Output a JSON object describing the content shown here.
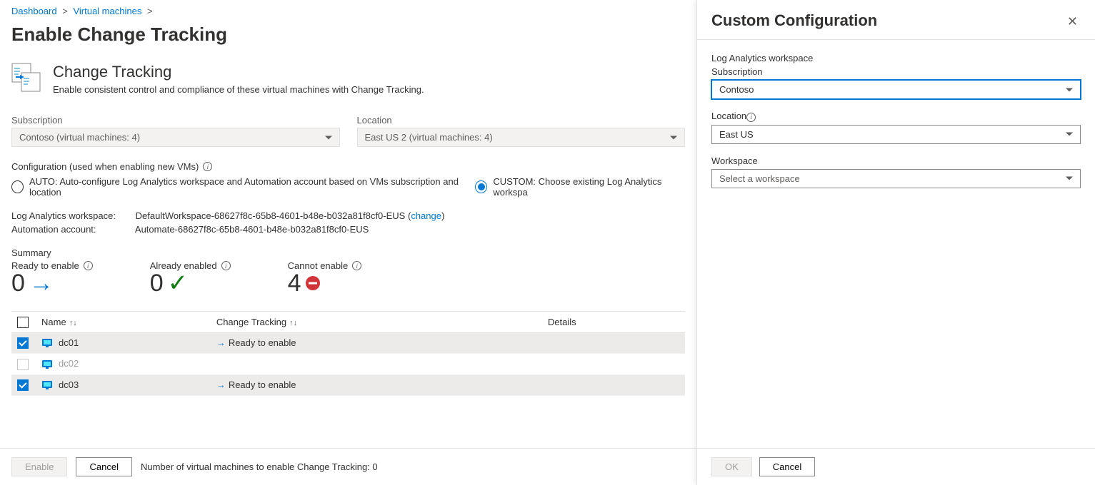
{
  "breadcrumb": {
    "dashboard": "Dashboard",
    "vms": "Virtual machines"
  },
  "page_title": "Enable Change Tracking",
  "feature": {
    "title": "Change Tracking",
    "desc": "Enable consistent control and compliance of these virtual machines with Change Tracking."
  },
  "filters": {
    "subscription_label": "Subscription",
    "subscription_value": "Contoso (virtual machines: 4)",
    "location_label": "Location",
    "location_value": "East US 2 (virtual machines: 4)"
  },
  "config": {
    "label": "Configuration (used when enabling new VMs)",
    "auto": "AUTO: Auto-configure Log Analytics workspace and Automation account based on VMs subscription and location",
    "custom": "CUSTOM: Choose existing Log Analytics workspa"
  },
  "workspace": {
    "label": "Log Analytics workspace:",
    "value": "DefaultWorkspace-68627f8c-65b8-4601-b48e-b032a81f8cf0-EUS",
    "change": "change"
  },
  "automation": {
    "label": "Automation account:",
    "value": "Automate-68627f8c-65b8-4601-b48e-b032a81f8cf0-EUS"
  },
  "summary": {
    "title": "Summary",
    "ready_label": "Ready to enable",
    "ready_value": "0",
    "already_label": "Already enabled",
    "already_value": "0",
    "cannot_label": "Cannot enable",
    "cannot_value": "4"
  },
  "table": {
    "col_name": "Name",
    "col_ct": "Change Tracking",
    "col_details": "Details",
    "rows": [
      {
        "name": "dc01",
        "status": "Ready to enable",
        "checked": true
      },
      {
        "name": "dc02",
        "status": "",
        "checked": false,
        "disabled": true
      },
      {
        "name": "dc03",
        "status": "Ready to enable",
        "checked": true
      }
    ]
  },
  "footer": {
    "enable": "Enable",
    "cancel": "Cancel",
    "count_text": "Number of virtual machines to enable Change Tracking: 0"
  },
  "panel": {
    "title": "Custom Configuration",
    "law_label": "Log Analytics workspace",
    "sub_label": "Subscription",
    "sub_value": "Contoso",
    "loc_label": "Location",
    "loc_value": "East US",
    "ws_label": "Workspace",
    "ws_placeholder": "Select a workspace",
    "ok": "OK",
    "cancel": "Cancel"
  }
}
